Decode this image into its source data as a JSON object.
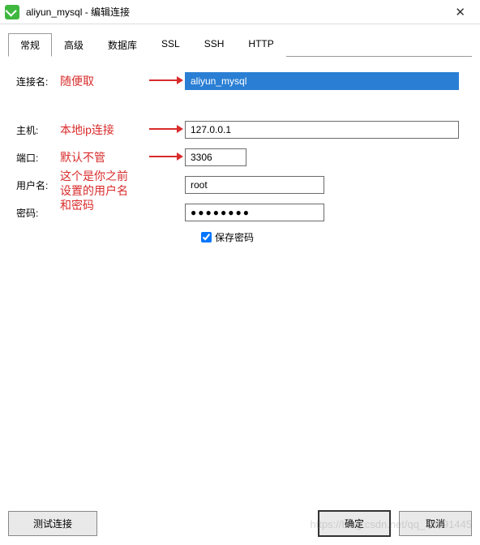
{
  "titlebar": {
    "title": "aliyun_mysql - 编辑连接"
  },
  "tabs": [
    "常规",
    "高级",
    "数据库",
    "SSL",
    "SSH",
    "HTTP"
  ],
  "labels": {
    "connName": "连接名:",
    "host": "主机:",
    "port": "端口:",
    "user": "用户名:",
    "pass": "密码:",
    "savePass": "保存密码"
  },
  "values": {
    "connName": "aliyun_mysql",
    "host": "127.0.0.1",
    "port": "3306",
    "user": "root",
    "pass": "●●●●●●●●"
  },
  "annotations": {
    "connName": "随便取",
    "host": "本地ip连接",
    "port": "默认不管",
    "userPass1": "这个是你之前",
    "userPass2": "设置的用户名",
    "userPass3": "和密码"
  },
  "buttons": {
    "test": "测试连接",
    "ok": "确定",
    "cancel": "取消"
  },
  "watermark": "https://blog.csdn.net/qq_38591445"
}
